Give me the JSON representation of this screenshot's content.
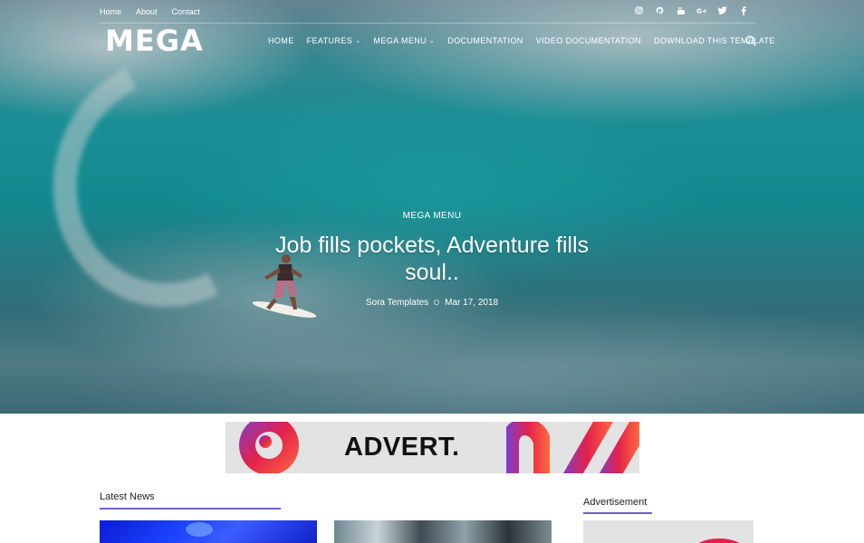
{
  "topbar": {
    "links": [
      "Home",
      "About",
      "Contact"
    ],
    "socials": [
      "instagram-icon",
      "pinterest-icon",
      "youtube-icon",
      "google-plus-icon",
      "twitter-icon",
      "facebook-icon"
    ]
  },
  "header": {
    "logo": "MEGA",
    "nav": [
      {
        "label": "HOME",
        "dropdown": false
      },
      {
        "label": "FEATURES",
        "dropdown": true
      },
      {
        "label": "MEGA MENU",
        "dropdown": true
      },
      {
        "label": "DOCUMENTATION",
        "dropdown": false
      },
      {
        "label": "VIDEO DOCUMENTATION",
        "dropdown": false
      },
      {
        "label": "DOWNLOAD THIS TEMPLATE",
        "dropdown": false
      }
    ],
    "search_icon": "search-icon"
  },
  "hero": {
    "category": "MEGA MENU",
    "title": "Job fills pockets, Adventure fills soul..",
    "author": "Sora Templates",
    "date": "Mar 17, 2018"
  },
  "advert": {
    "text": "ADVERT."
  },
  "latest": {
    "title": "Latest News"
  },
  "sidebar": {
    "title": "Advertisement"
  },
  "colors": {
    "accent": "#6a64c8",
    "hero_teal": "#17a2a8",
    "ad_pink": "#e2214b"
  }
}
